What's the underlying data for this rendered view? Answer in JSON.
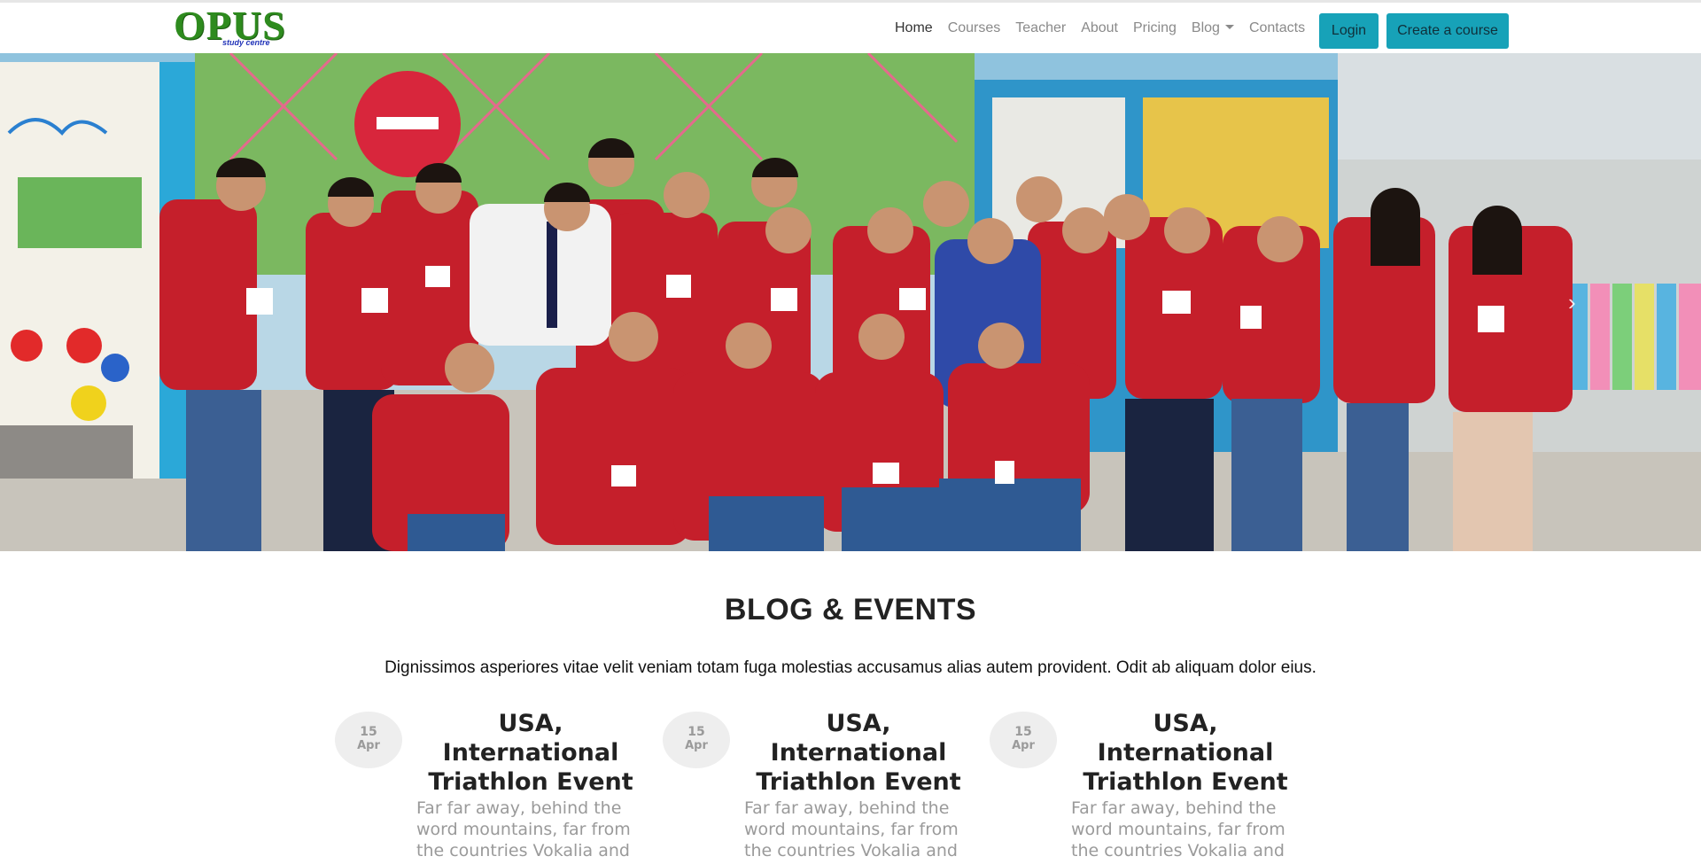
{
  "brand": {
    "name": "OPUS",
    "tagline": "study centre",
    "color": "#2e8b1e"
  },
  "nav": {
    "links": [
      {
        "label": "Home",
        "active": true
      },
      {
        "label": "Courses"
      },
      {
        "label": "Teacher"
      },
      {
        "label": "About"
      },
      {
        "label": "Pricing"
      },
      {
        "label": "Blog",
        "dropdown": true
      },
      {
        "label": "Contacts"
      }
    ],
    "login_label": "Login",
    "create_label": "Create a course",
    "accent": "#17a2b8"
  },
  "hero": {
    "image": "group-photo-of-students-in-red-shirts",
    "next_icon": "chevron-right-icon",
    "next_glyph": "›"
  },
  "blog": {
    "title": "BLOG & EVENTS",
    "description": "Dignissimos asperiores vitae velit veniam totam fuga molestias accusamus alias autem provident. Odit ab aliquam dolor eius.",
    "cards": [
      {
        "day": "15",
        "month": "Apr",
        "title": "USA, International Triathlon Event",
        "text": "Far far away, behind the word mountains, far from the countries Vokalia and"
      },
      {
        "day": "15",
        "month": "Apr",
        "title": "USA, International Triathlon Event",
        "text": "Far far away, behind the word mountains, far from the countries Vokalia and"
      },
      {
        "day": "15",
        "month": "Apr",
        "title": "USA, International Triathlon Event",
        "text": "Far far away, behind the word mountains, far from the countries Vokalia and"
      }
    ]
  }
}
